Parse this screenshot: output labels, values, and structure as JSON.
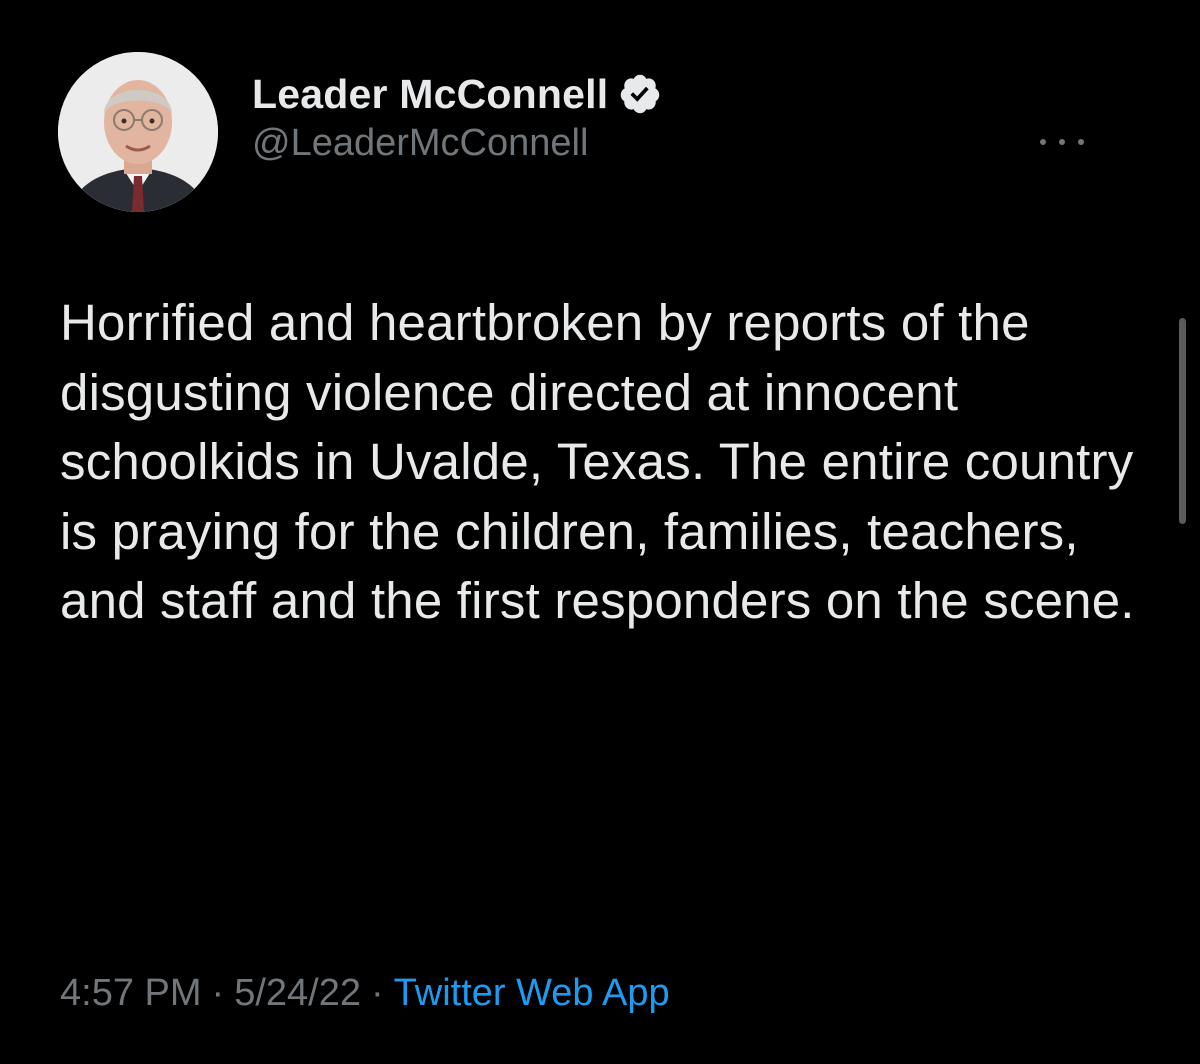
{
  "author": {
    "display_name": "Leader McConnell",
    "handle": "@LeaderMcConnell",
    "verified_icon": "verified-badge-icon",
    "avatar": "profile-photo"
  },
  "tweet": {
    "text": "Horrified and heartbroken by reports of the disgusting violence directed at innocent schoolkids in Uvalde, Texas. The entire country is praying for the children, families, teachers, and staff and the first responders on the scene.",
    "time": "4:57 PM",
    "separator": "·",
    "date": "5/24/22",
    "source": "Twitter Web App"
  },
  "menu_icon": "more-options-icon",
  "colors": {
    "background": "#000000",
    "text": "#e7e9ea",
    "secondary_text": "#71767b",
    "link": "#1d9bf0",
    "verified_badge": "#e7e9ea"
  }
}
